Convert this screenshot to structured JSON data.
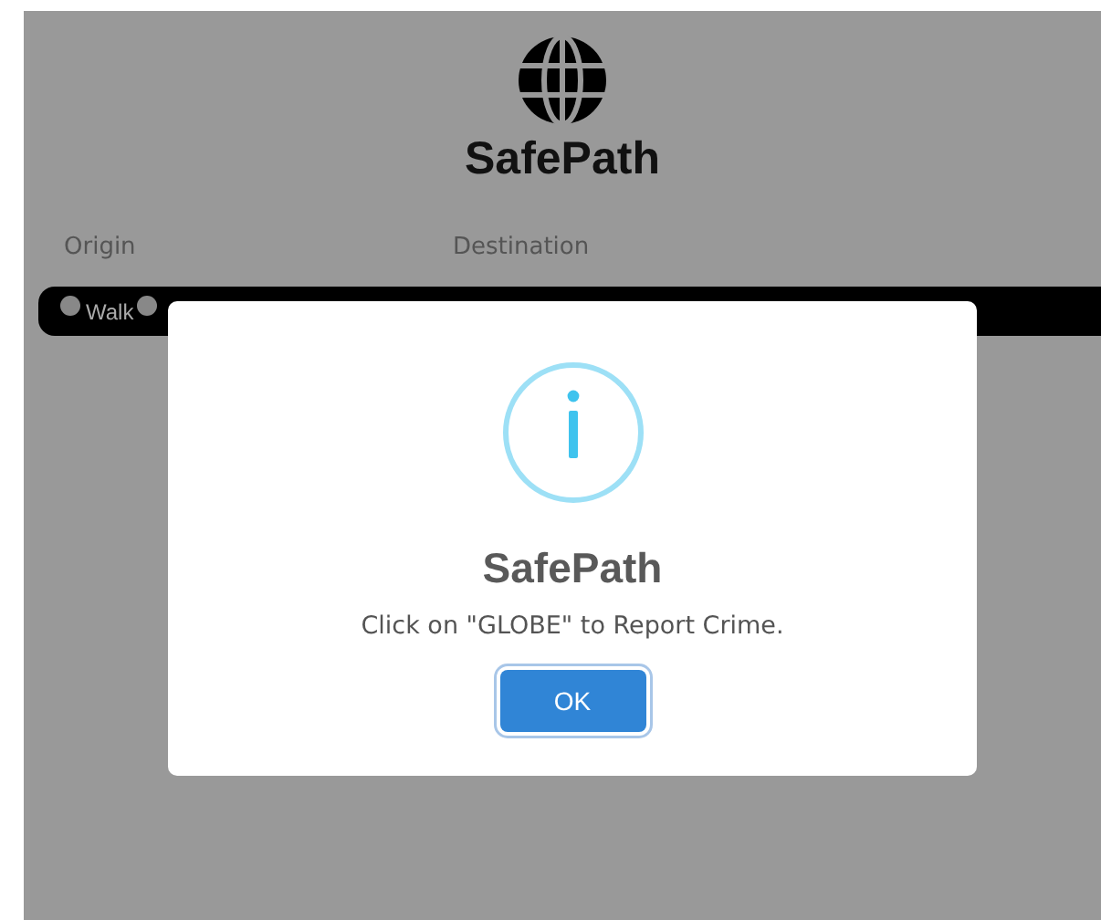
{
  "app": {
    "title": "SafePath"
  },
  "fields": [
    {
      "label": "Origin"
    },
    {
      "label": "Destination"
    }
  ],
  "modes": [
    {
      "label": "Walk",
      "selected": false
    },
    {
      "selected": false
    }
  ],
  "dialog": {
    "kind": "info",
    "title": "SafePath",
    "message": "Click on \"GLOBE\" to Report Crime.",
    "button": "OK"
  }
}
